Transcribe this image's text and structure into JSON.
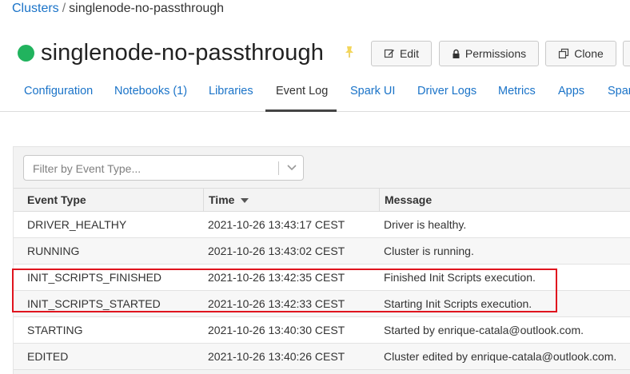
{
  "breadcrumb": {
    "parent": "Clusters",
    "separator": "/",
    "current": "singlenode-no-passthrough"
  },
  "cluster": {
    "name": "singlenode-no-passthrough",
    "status_color": "#21b35e"
  },
  "icons": {
    "status": "status-dot",
    "pin": "pin-icon",
    "edit": "pencil-icon",
    "permissions": "lock-icon",
    "clone": "clone-icon",
    "filter_chevron": "chevron-down-icon"
  },
  "toolbar": {
    "edit_label": "Edit",
    "permissions_label": "Permissions",
    "clone_label": "Clone"
  },
  "tabs": [
    {
      "label": "Configuration",
      "active": false
    },
    {
      "label": "Notebooks (1)",
      "active": false
    },
    {
      "label": "Libraries",
      "active": false
    },
    {
      "label": "Event Log",
      "active": true
    },
    {
      "label": "Spark UI",
      "active": false
    },
    {
      "label": "Driver Logs",
      "active": false
    },
    {
      "label": "Metrics",
      "active": false
    },
    {
      "label": "Apps",
      "active": false
    },
    {
      "label": "Spark",
      "active": false
    }
  ],
  "filter": {
    "placeholder": "Filter by Event Type..."
  },
  "table": {
    "columns": [
      "Event Type",
      "Time",
      "Message"
    ],
    "sort_column": "Time",
    "sort_direction": "descending",
    "rows": [
      {
        "event_type": "DRIVER_HEALTHY",
        "time": "2021-10-26 13:43:17 CEST",
        "message": "Driver is healthy."
      },
      {
        "event_type": "RUNNING",
        "time": "2021-10-26 13:43:02 CEST",
        "message": "Cluster is running."
      },
      {
        "event_type": "INIT_SCRIPTS_FINISHED",
        "time": "2021-10-26 13:42:35 CEST",
        "message": "Finished Init Scripts execution."
      },
      {
        "event_type": "INIT_SCRIPTS_STARTED",
        "time": "2021-10-26 13:42:33 CEST",
        "message": "Starting Init Scripts execution."
      },
      {
        "event_type": "STARTING",
        "time": "2021-10-26 13:40:30 CEST",
        "message": "Started by enrique-catala@outlook.com."
      },
      {
        "event_type": "EDITED",
        "time": "2021-10-26 13:40:26 CEST",
        "message": "Cluster edited by enrique-catala@outlook.com."
      }
    ]
  },
  "highlight_color": "#e0141e"
}
